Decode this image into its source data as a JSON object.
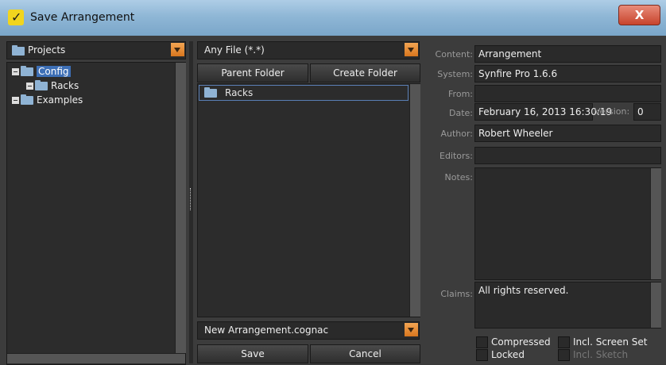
{
  "window": {
    "title": "Save Arrangement",
    "close_label": "X"
  },
  "left": {
    "combo_label": "Projects",
    "tree": [
      {
        "label": "Config",
        "selected": true
      },
      {
        "label": "Racks"
      },
      {
        "label": "Examples"
      }
    ]
  },
  "middle": {
    "filter_label": "Any File (*.*)",
    "parent_folder_label": "Parent Folder",
    "create_folder_label": "Create Folder",
    "files": [
      {
        "label": "Racks"
      }
    ],
    "filename_value": "New Arrangement.cognac",
    "save_label": "Save",
    "cancel_label": "Cancel"
  },
  "right": {
    "content_label": "Content:",
    "content_value": "Arrangement",
    "system_label": "System:",
    "system_value": "Synfire Pro 1.6.6",
    "from_label": "From:",
    "from_value": "",
    "date_label": "Date:",
    "date_value": "February 16, 2013 16:30:19",
    "version_label": "Version:",
    "version_value": "0",
    "author_label": "Author:",
    "author_value": "Robert Wheeler",
    "editors_label": "Editors:",
    "editors_value": "",
    "notes_label": "Notes:",
    "notes_value": "",
    "claims_label": "Claims:",
    "claims_value": "All rights reserved.",
    "compressed_label": "Compressed",
    "locked_label": "Locked",
    "incl_screen_set_label": "Incl. Screen Set",
    "incl_sketch_label": "Incl. Sketch"
  }
}
